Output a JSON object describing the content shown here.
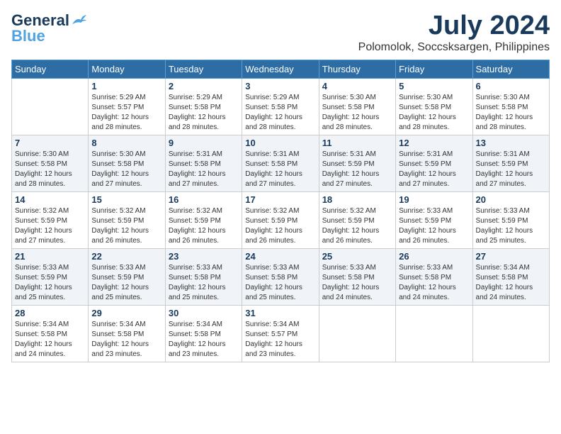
{
  "logo": {
    "line1": "General",
    "line2": "Blue"
  },
  "title": "July 2024",
  "location": "Polomolok, Soccsksargen, Philippines",
  "weekdays": [
    "Sunday",
    "Monday",
    "Tuesday",
    "Wednesday",
    "Thursday",
    "Friday",
    "Saturday"
  ],
  "weeks": [
    [
      {
        "day": "",
        "info": ""
      },
      {
        "day": "1",
        "info": "Sunrise: 5:29 AM\nSunset: 5:57 PM\nDaylight: 12 hours\nand 28 minutes."
      },
      {
        "day": "2",
        "info": "Sunrise: 5:29 AM\nSunset: 5:58 PM\nDaylight: 12 hours\nand 28 minutes."
      },
      {
        "day": "3",
        "info": "Sunrise: 5:29 AM\nSunset: 5:58 PM\nDaylight: 12 hours\nand 28 minutes."
      },
      {
        "day": "4",
        "info": "Sunrise: 5:30 AM\nSunset: 5:58 PM\nDaylight: 12 hours\nand 28 minutes."
      },
      {
        "day": "5",
        "info": "Sunrise: 5:30 AM\nSunset: 5:58 PM\nDaylight: 12 hours\nand 28 minutes."
      },
      {
        "day": "6",
        "info": "Sunrise: 5:30 AM\nSunset: 5:58 PM\nDaylight: 12 hours\nand 28 minutes."
      }
    ],
    [
      {
        "day": "7",
        "info": "Sunrise: 5:30 AM\nSunset: 5:58 PM\nDaylight: 12 hours\nand 28 minutes."
      },
      {
        "day": "8",
        "info": "Sunrise: 5:30 AM\nSunset: 5:58 PM\nDaylight: 12 hours\nand 27 minutes."
      },
      {
        "day": "9",
        "info": "Sunrise: 5:31 AM\nSunset: 5:58 PM\nDaylight: 12 hours\nand 27 minutes."
      },
      {
        "day": "10",
        "info": "Sunrise: 5:31 AM\nSunset: 5:58 PM\nDaylight: 12 hours\nand 27 minutes."
      },
      {
        "day": "11",
        "info": "Sunrise: 5:31 AM\nSunset: 5:59 PM\nDaylight: 12 hours\nand 27 minutes."
      },
      {
        "day": "12",
        "info": "Sunrise: 5:31 AM\nSunset: 5:59 PM\nDaylight: 12 hours\nand 27 minutes."
      },
      {
        "day": "13",
        "info": "Sunrise: 5:31 AM\nSunset: 5:59 PM\nDaylight: 12 hours\nand 27 minutes."
      }
    ],
    [
      {
        "day": "14",
        "info": "Sunrise: 5:32 AM\nSunset: 5:59 PM\nDaylight: 12 hours\nand 27 minutes."
      },
      {
        "day": "15",
        "info": "Sunrise: 5:32 AM\nSunset: 5:59 PM\nDaylight: 12 hours\nand 26 minutes."
      },
      {
        "day": "16",
        "info": "Sunrise: 5:32 AM\nSunset: 5:59 PM\nDaylight: 12 hours\nand 26 minutes."
      },
      {
        "day": "17",
        "info": "Sunrise: 5:32 AM\nSunset: 5:59 PM\nDaylight: 12 hours\nand 26 minutes."
      },
      {
        "day": "18",
        "info": "Sunrise: 5:32 AM\nSunset: 5:59 PM\nDaylight: 12 hours\nand 26 minutes."
      },
      {
        "day": "19",
        "info": "Sunrise: 5:33 AM\nSunset: 5:59 PM\nDaylight: 12 hours\nand 26 minutes."
      },
      {
        "day": "20",
        "info": "Sunrise: 5:33 AM\nSunset: 5:59 PM\nDaylight: 12 hours\nand 25 minutes."
      }
    ],
    [
      {
        "day": "21",
        "info": "Sunrise: 5:33 AM\nSunset: 5:59 PM\nDaylight: 12 hours\nand 25 minutes."
      },
      {
        "day": "22",
        "info": "Sunrise: 5:33 AM\nSunset: 5:59 PM\nDaylight: 12 hours\nand 25 minutes."
      },
      {
        "day": "23",
        "info": "Sunrise: 5:33 AM\nSunset: 5:58 PM\nDaylight: 12 hours\nand 25 minutes."
      },
      {
        "day": "24",
        "info": "Sunrise: 5:33 AM\nSunset: 5:58 PM\nDaylight: 12 hours\nand 25 minutes."
      },
      {
        "day": "25",
        "info": "Sunrise: 5:33 AM\nSunset: 5:58 PM\nDaylight: 12 hours\nand 24 minutes."
      },
      {
        "day": "26",
        "info": "Sunrise: 5:33 AM\nSunset: 5:58 PM\nDaylight: 12 hours\nand 24 minutes."
      },
      {
        "day": "27",
        "info": "Sunrise: 5:34 AM\nSunset: 5:58 PM\nDaylight: 12 hours\nand 24 minutes."
      }
    ],
    [
      {
        "day": "28",
        "info": "Sunrise: 5:34 AM\nSunset: 5:58 PM\nDaylight: 12 hours\nand 24 minutes."
      },
      {
        "day": "29",
        "info": "Sunrise: 5:34 AM\nSunset: 5:58 PM\nDaylight: 12 hours\nand 23 minutes."
      },
      {
        "day": "30",
        "info": "Sunrise: 5:34 AM\nSunset: 5:58 PM\nDaylight: 12 hours\nand 23 minutes."
      },
      {
        "day": "31",
        "info": "Sunrise: 5:34 AM\nSunset: 5:57 PM\nDaylight: 12 hours\nand 23 minutes."
      },
      {
        "day": "",
        "info": ""
      },
      {
        "day": "",
        "info": ""
      },
      {
        "day": "",
        "info": ""
      }
    ]
  ]
}
